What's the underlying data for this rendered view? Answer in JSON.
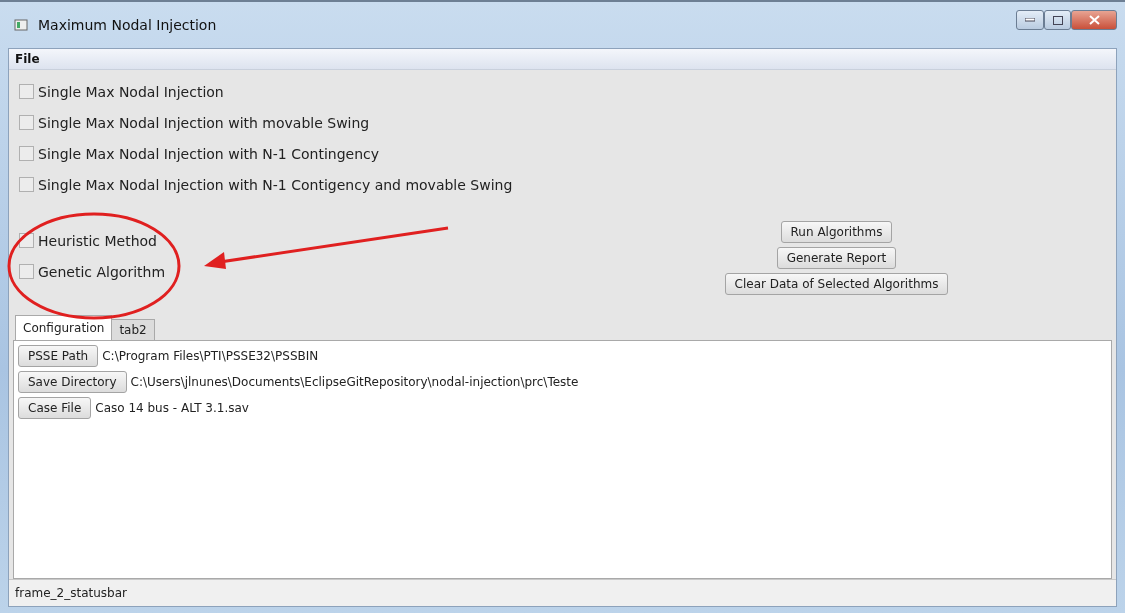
{
  "window": {
    "title": "Maximum Nodal Injection"
  },
  "menu": [
    "File"
  ],
  "algorithms": [
    {
      "label": "Single Max Nodal Injection",
      "checked": false
    },
    {
      "label": "Single Max Nodal Injection with movable Swing",
      "checked": false
    },
    {
      "label": "Single Max Nodal Injection with N-1 Contingency",
      "checked": false
    },
    {
      "label": "Single Max Nodal Injection with N-1 Contigency and movable Swing",
      "checked": false
    }
  ],
  "methods": [
    {
      "label": "Heuristic Method",
      "checked": false
    },
    {
      "label": "Genetic Algorithm",
      "checked": false
    }
  ],
  "actions": [
    "Run Algorithms",
    "Generate Report",
    "Clear Data of Selected Algorithms"
  ],
  "tabs": [
    {
      "label": "Configuration",
      "selected": true
    },
    {
      "label": "tab2",
      "selected": false
    }
  ],
  "config": [
    {
      "button": "PSSE Path",
      "value": "C:\\Program Files\\PTI\\PSSE32\\PSSBIN"
    },
    {
      "button": "Save Directory",
      "value": "C:\\Users\\jlnunes\\Documents\\EclipseGitRepository\\nodal-injection\\prc\\Teste"
    },
    {
      "button": "Case File",
      "value": "Caso 14 bus - ALT 3.1.sav"
    }
  ],
  "status_bar": "frame_2_statusbar"
}
